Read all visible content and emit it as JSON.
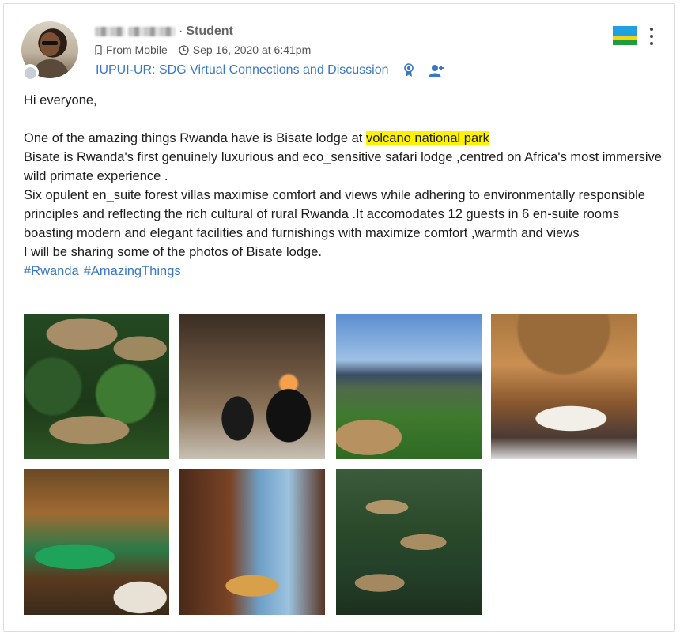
{
  "post": {
    "role": "Student",
    "source": "From Mobile",
    "timestamp": "Sep 16, 2020 at 6:41pm",
    "group": "IUPUI-UR: SDG Virtual Connections and Discussion",
    "greeting": "Hi everyone,",
    "para1_before": "One of the amazing things Rwanda have is Bisate lodge at ",
    "para1_highlight": "volcano national park",
    "para2": "Bisate is Rwanda's first genuinely luxurious and eco_sensitive safari lodge ,centred on Africa's most immersive wild primate experience .",
    "para3": "Six opulent en_suite forest villas maximise comfort and views while adhering to environmentally responsible principles and reflecting the rich cultural of rural Rwanda .It accomodates 12 guests in 6 en-suite rooms boasting modern and elegant facilities and furnishings with maximize comfort ,warmth and views",
    "para4": "I will be sharing some of the photos of Bisate lodge.",
    "hashtags": [
      "#Rwanda",
      "#AmazingThings"
    ]
  },
  "icons": {
    "source": "mobile-icon",
    "time": "clock-icon",
    "badge": "award-ribbon-icon",
    "people": "user-add-icon",
    "flag": "rwanda-flag-icon",
    "menu": "more-vertical-icon"
  },
  "colors": {
    "link": "#3a78c5",
    "highlight": "#fff200",
    "presence": "#c9ced6"
  },
  "photos": [
    "bisate-villas-forest",
    "bisate-dining-room",
    "volcano-view",
    "bisate-bedroom",
    "bisate-bar",
    "bisate-dining-view",
    "bisate-villas-hillside"
  ]
}
